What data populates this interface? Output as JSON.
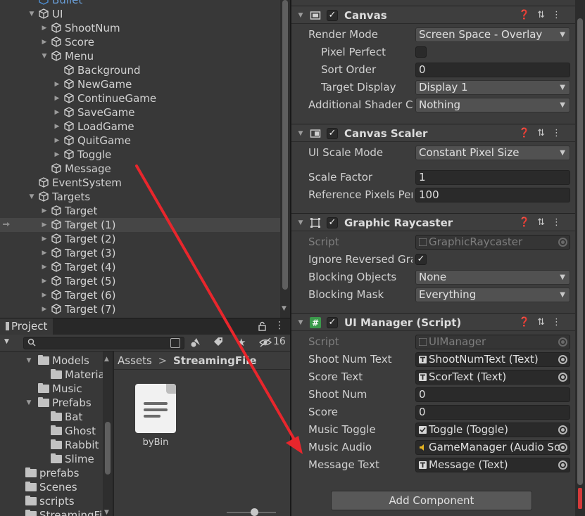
{
  "hierarchy": {
    "top_partial": "Bullet",
    "items": [
      {
        "label": "UI",
        "depth": 2,
        "fold": "open",
        "icon": "cube"
      },
      {
        "label": "ShootNum",
        "depth": 3,
        "fold": "closed",
        "icon": "cube"
      },
      {
        "label": "Score",
        "depth": 3,
        "fold": "closed",
        "icon": "cube"
      },
      {
        "label": "Menu",
        "depth": 3,
        "fold": "open",
        "icon": "cube"
      },
      {
        "label": "Background",
        "depth": 4,
        "fold": "none",
        "icon": "cube"
      },
      {
        "label": "NewGame",
        "depth": 4,
        "fold": "closed",
        "icon": "cube"
      },
      {
        "label": "ContinueGame",
        "depth": 4,
        "fold": "closed",
        "icon": "cube"
      },
      {
        "label": "SaveGame",
        "depth": 4,
        "fold": "closed",
        "icon": "cube"
      },
      {
        "label": "LoadGame",
        "depth": 4,
        "fold": "closed",
        "icon": "cube"
      },
      {
        "label": "QuitGame",
        "depth": 4,
        "fold": "closed",
        "icon": "cube"
      },
      {
        "label": "Toggle",
        "depth": 4,
        "fold": "closed",
        "icon": "cube"
      },
      {
        "label": "Message",
        "depth": 3,
        "fold": "none",
        "icon": "cube"
      },
      {
        "label": "EventSystem",
        "depth": 2,
        "fold": "none",
        "icon": "cube"
      },
      {
        "label": "Targets",
        "depth": 2,
        "fold": "open",
        "icon": "cube"
      },
      {
        "label": "Target",
        "depth": 3,
        "fold": "closed",
        "icon": "cube"
      },
      {
        "label": "Target (1)",
        "depth": 3,
        "fold": "closed",
        "icon": "cube",
        "hover": true
      },
      {
        "label": "Target (2)",
        "depth": 3,
        "fold": "closed",
        "icon": "cube"
      },
      {
        "label": "Target (3)",
        "depth": 3,
        "fold": "closed",
        "icon": "cube"
      },
      {
        "label": "Target (4)",
        "depth": 3,
        "fold": "closed",
        "icon": "cube"
      },
      {
        "label": "Target (5)",
        "depth": 3,
        "fold": "closed",
        "icon": "cube"
      },
      {
        "label": "Target (6)",
        "depth": 3,
        "fold": "closed",
        "icon": "cube"
      },
      {
        "label": "Target (7)",
        "depth": 3,
        "fold": "closed",
        "icon": "cube"
      }
    ]
  },
  "project": {
    "tab_label": "Project",
    "hidden_count": "16",
    "search_value": "",
    "tree": [
      {
        "label": "Models",
        "depth": 1,
        "fold": "open"
      },
      {
        "label": "Materials",
        "depth": 2,
        "fold": "none"
      },
      {
        "label": "Music",
        "depth": 1,
        "fold": "none"
      },
      {
        "label": "Prefabs",
        "depth": 1,
        "fold": "open"
      },
      {
        "label": "Bat",
        "depth": 2,
        "fold": "none"
      },
      {
        "label": "Ghost",
        "depth": 2,
        "fold": "none"
      },
      {
        "label": "Rabbit",
        "depth": 2,
        "fold": "none"
      },
      {
        "label": "Slime",
        "depth": 2,
        "fold": "none"
      },
      {
        "label": "prefabs",
        "depth": 0,
        "fold": "none"
      },
      {
        "label": "Scenes",
        "depth": 0,
        "fold": "none"
      },
      {
        "label": "scripts",
        "depth": 0,
        "fold": "none"
      },
      {
        "label": "StreamingFile",
        "depth": 0,
        "fold": "none"
      }
    ],
    "breadcrumb": {
      "root": "Assets",
      "separator": ">",
      "current": "StreamingFile"
    },
    "files": [
      {
        "name": "byBin",
        "icon": "text-file-icon"
      }
    ]
  },
  "inspector": {
    "canvas": {
      "title": "Canvas",
      "props": [
        {
          "label": "Render Mode",
          "value": "Screen Space - Overlay",
          "type": "dropdown"
        },
        {
          "label": "Pixel Perfect",
          "value": "",
          "type": "checkbox",
          "checked": false
        },
        {
          "label": "Sort Order",
          "value": "0",
          "type": "text"
        },
        {
          "label": "Target Display",
          "value": "Display 1",
          "type": "dropdown"
        },
        {
          "label": "Additional Shader Ch",
          "value": "Nothing",
          "type": "dropdown"
        }
      ]
    },
    "scaler": {
      "title": "Canvas Scaler",
      "props": [
        {
          "label": "UI Scale Mode",
          "value": "Constant Pixel Size",
          "type": "dropdown"
        },
        {
          "label": "Scale Factor",
          "value": "1",
          "type": "text"
        },
        {
          "label": "Reference Pixels Per",
          "value": "100",
          "type": "text"
        }
      ]
    },
    "raycaster": {
      "title": "Graphic Raycaster",
      "props": [
        {
          "label": "Script",
          "value": "GraphicRaycaster",
          "type": "object-disabled"
        },
        {
          "label": "Ignore Reversed Grap",
          "value": "",
          "type": "checkbox",
          "checked": true
        },
        {
          "label": "Blocking Objects",
          "value": "None",
          "type": "dropdown"
        },
        {
          "label": "Blocking Mask",
          "value": "Everything",
          "type": "dropdown"
        }
      ]
    },
    "uimanager": {
      "title": "UI Manager (Script)",
      "props": [
        {
          "label": "Script",
          "value": "UIManager",
          "type": "object-disabled"
        },
        {
          "label": "Shoot Num Text",
          "value": "ShootNumText (Text)",
          "type": "object",
          "icon": "T"
        },
        {
          "label": "Score Text",
          "value": "ScorText (Text)",
          "type": "object",
          "icon": "T"
        },
        {
          "label": "Shoot Num",
          "value": "0",
          "type": "text"
        },
        {
          "label": "Score",
          "value": "0",
          "type": "text"
        },
        {
          "label": "Music Toggle",
          "value": "Toggle (Toggle)",
          "type": "object",
          "icon": "check"
        },
        {
          "label": "Music Audio",
          "value": "GameManager (Audio So",
          "type": "object",
          "icon": "audio"
        },
        {
          "label": "Message Text",
          "value": "Message (Text)",
          "type": "object",
          "icon": "T"
        }
      ]
    },
    "add_component": "Add Component"
  },
  "colors": {
    "panel": "#383838",
    "inspector": "#3c3c3c",
    "field": "#2a2a2a",
    "arrow": "#e8262c",
    "script_icon": "#3b9a4b"
  }
}
